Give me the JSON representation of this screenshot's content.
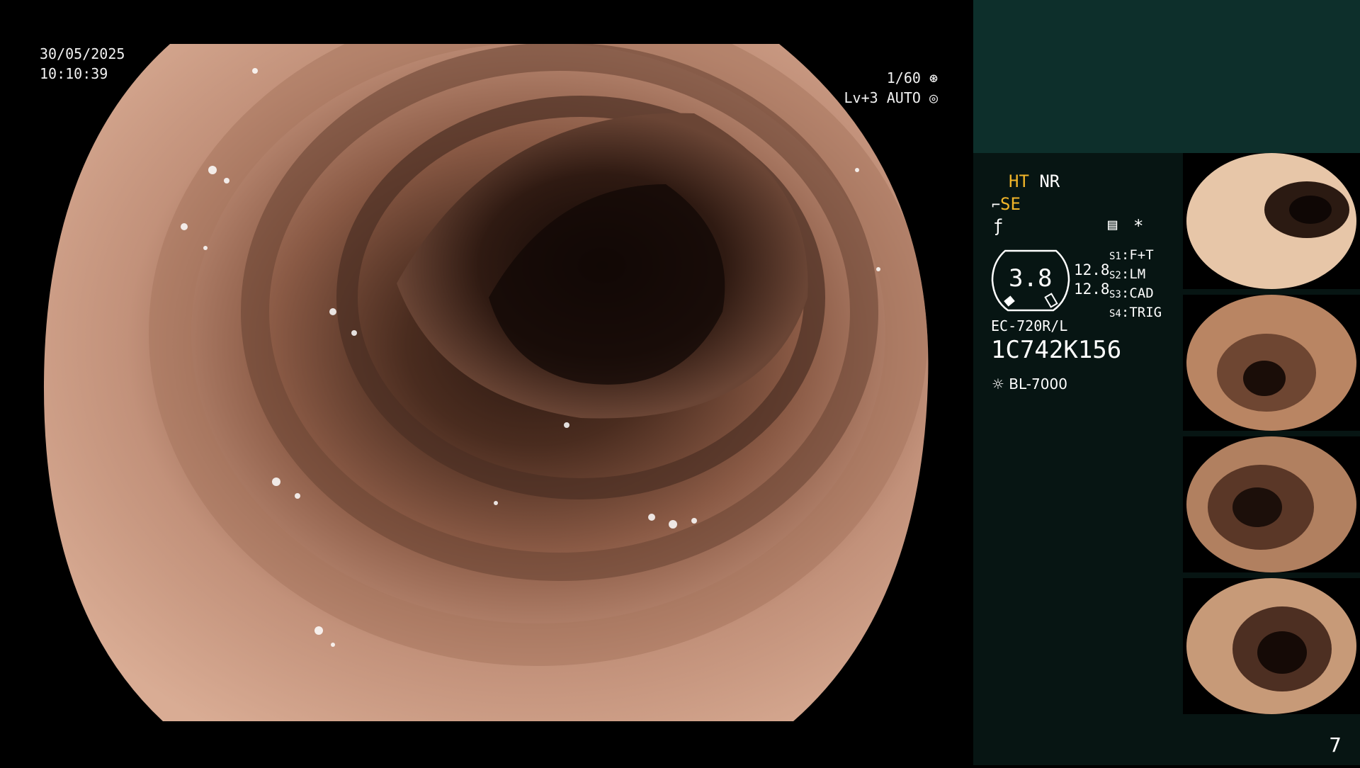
{
  "overlay": {
    "date": "30/05/2025",
    "time": "10:10:39",
    "shutter": "1/60",
    "level": "Lv+3",
    "mode": "AUTO"
  },
  "panel": {
    "ht": "HT",
    "nr": "NR",
    "se": "SE",
    "star": "*",
    "magnification": "3.8",
    "values": [
      "12.8",
      "12.8"
    ],
    "switches": [
      {
        "key": "S1",
        "value": "F+T"
      },
      {
        "key": "S2",
        "value": "LM"
      },
      {
        "key": "S3",
        "value": "CAD"
      },
      {
        "key": "S4",
        "value": "TRIG"
      }
    ],
    "scope_model": "EC-720R/L",
    "serial": "1C742K156",
    "light_source": "BL-7000",
    "page_number": "7"
  },
  "colors": {
    "highlight": "#f0b429",
    "panel_top": "#0d2f2b",
    "panel_bottom": "#071513",
    "mucosa": "#c89a7e"
  },
  "icons": [
    "shutter-icon",
    "auto-iris-icon",
    "curve-icon",
    "enhance-icon",
    "menu-icon",
    "lamp-icon"
  ]
}
